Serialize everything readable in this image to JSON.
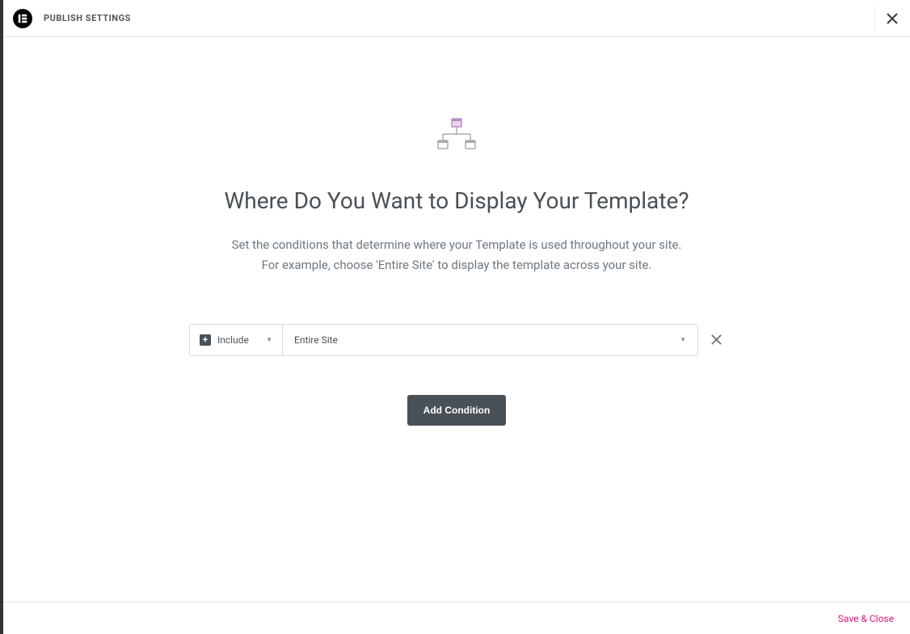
{
  "header": {
    "title": "PUBLISH SETTINGS"
  },
  "main": {
    "heading": "Where Do You Want to Display Your Template?",
    "subtitle_line1": "Set the conditions that determine where your Template is used throughout your site.",
    "subtitle_line2": "For example, choose 'Entire Site' to display the template across your site."
  },
  "condition": {
    "include_label": "Include",
    "scope_label": "Entire Site"
  },
  "buttons": {
    "add_condition": "Add Condition"
  },
  "footer": {
    "save_close": "Save & Close"
  }
}
